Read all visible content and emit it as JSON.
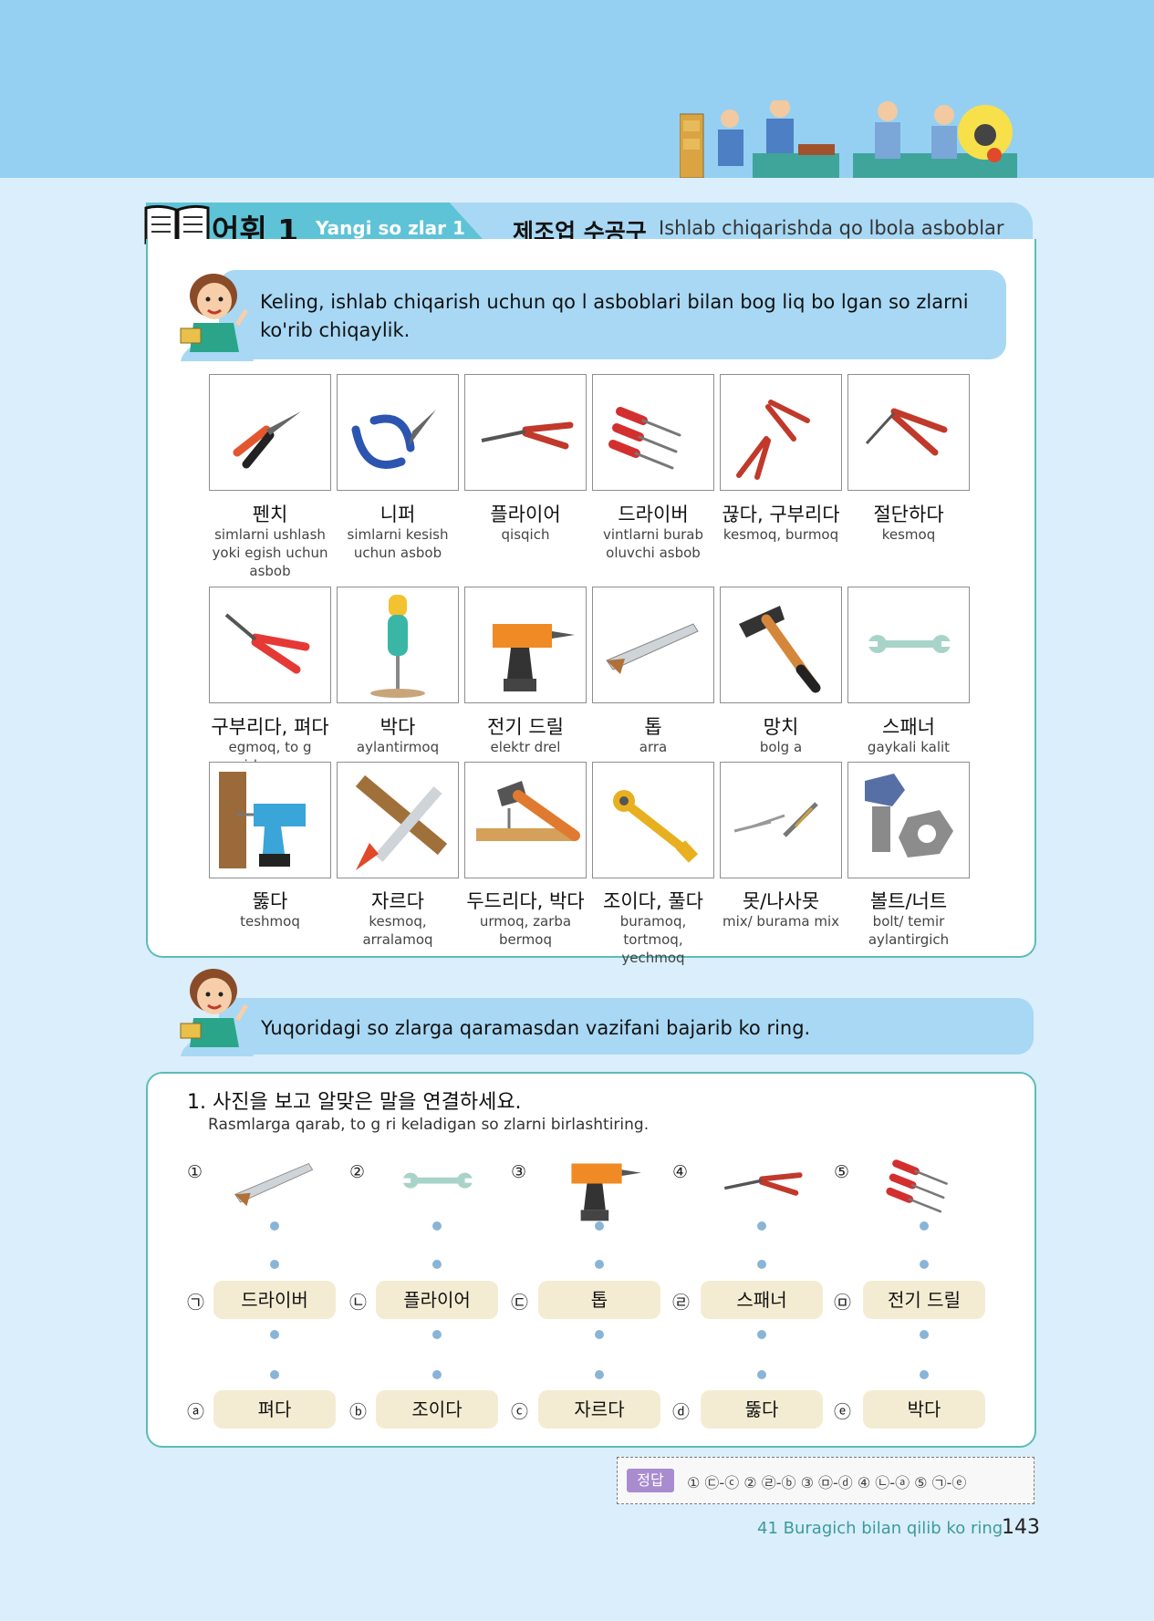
{
  "header": {
    "section_korean": "어휘 1",
    "section_uzbek": "Yangi so zlar 1",
    "title_korean": "제조업 수공구",
    "title_uzbek": "Ishlab chiqarishda qo lbola asboblar"
  },
  "intro": {
    "text": "Keling, ishlab chiqarish uchun qo l asboblari bilan bog liq bo lgan so zlarni ko'rib chiqaylik."
  },
  "vocab": [
    {
      "kor": "펜치",
      "uz": "simlarni ushlash yoki egish uchun asbob",
      "icon": "combination-pliers-icon"
    },
    {
      "kor": "니퍼",
      "uz": "simlarni kesish uchun asbob",
      "icon": "wire-cutter-icon"
    },
    {
      "kor": "플라이어",
      "uz": "qisqich",
      "icon": "long-nose-pliers-icon"
    },
    {
      "kor": "드라이버",
      "uz": "vintlarni burab oluvchi asbob",
      "icon": "screwdrivers-icon"
    },
    {
      "kor": "끊다, 구부리다",
      "uz": "kesmoq, burmoq",
      "icon": "cut-bend-pliers-icon"
    },
    {
      "kor": "절단하다",
      "uz": "kesmoq",
      "icon": "cutting-pliers-icon"
    },
    {
      "kor": "구부리다, 펴다",
      "uz": "egmoq, to g irlamoq",
      "icon": "bending-pliers-icon"
    },
    {
      "kor": "박다",
      "uz": "aylantirmoq",
      "icon": "screwing-icon"
    },
    {
      "kor": "전기 드릴",
      "uz": "elektr drel",
      "icon": "electric-drill-icon"
    },
    {
      "kor": "톱",
      "uz": "arra",
      "icon": "saw-icon"
    },
    {
      "kor": "망치",
      "uz": "bolg a",
      "icon": "hammer-icon"
    },
    {
      "kor": "스패너",
      "uz": "gaykali kalit",
      "icon": "spanner-icon"
    },
    {
      "kor": "뚫다",
      "uz": "teshmoq",
      "icon": "drilling-icon"
    },
    {
      "kor": "자르다",
      "uz": "kesmoq, arralamoq",
      "icon": "sawing-icon"
    },
    {
      "kor": "두드리다, 박다",
      "uz": "urmoq, zarba bermoq",
      "icon": "hammering-icon"
    },
    {
      "kor": "조이다, 풀다",
      "uz": "buramoq, tortmoq, yechmoq",
      "icon": "tightening-icon"
    },
    {
      "kor": "못/나사못",
      "uz": "mix/ burama mix",
      "icon": "nails-screws-icon"
    },
    {
      "kor": "볼트/너트",
      "uz": "bolt/ temir aylantirgich",
      "icon": "bolt-nut-icon"
    }
  ],
  "task_intro": {
    "text": "Yuqoridagi so zlarga qaramasdan vazifani bajarib ko ring."
  },
  "exercise": {
    "title": "1. 사진을 보고 알맞은 말을 연결하세요.",
    "subtitle": "Rasmlarga qarab, to g ri keladigan so zlarni birlashtiring.",
    "pictures": [
      {
        "num": "①",
        "icon": "saw-icon"
      },
      {
        "num": "②",
        "icon": "spanner-icon"
      },
      {
        "num": "③",
        "icon": "electric-drill-icon"
      },
      {
        "num": "④",
        "icon": "long-nose-pliers-icon"
      },
      {
        "num": "⑤",
        "icon": "screwdrivers-icon"
      }
    ],
    "nouns": [
      {
        "mark": "㉠",
        "label": "드라이버"
      },
      {
        "mark": "㉡",
        "label": "플라이어"
      },
      {
        "mark": "㉢",
        "label": "톱"
      },
      {
        "mark": "㉣",
        "label": "스패너"
      },
      {
        "mark": "㉤",
        "label": "전기 드릴"
      }
    ],
    "verbs": [
      {
        "mark": "ⓐ",
        "label": "펴다"
      },
      {
        "mark": "ⓑ",
        "label": "조이다"
      },
      {
        "mark": "ⓒ",
        "label": "자르다"
      },
      {
        "mark": "ⓓ",
        "label": "뚫다"
      },
      {
        "mark": "ⓔ",
        "label": "박다"
      }
    ]
  },
  "answer": {
    "label": "정답",
    "text": "① ㉢-ⓒ  ② ㉣-ⓑ  ③ ㉤-ⓓ  ④ ㉡-ⓐ  ⑤ ㉠-ⓔ"
  },
  "footer": {
    "lesson": "41 Buragich bilan qilib ko ring",
    "page": "143"
  },
  "colors": {
    "top_band": "#95d0f3",
    "page_bg": "#dbeefb",
    "header_tab": "#5ec3d6",
    "panel_border": "#5bbdb6",
    "pill": "#f4ecd2",
    "answer_label": "#a98bd0"
  }
}
